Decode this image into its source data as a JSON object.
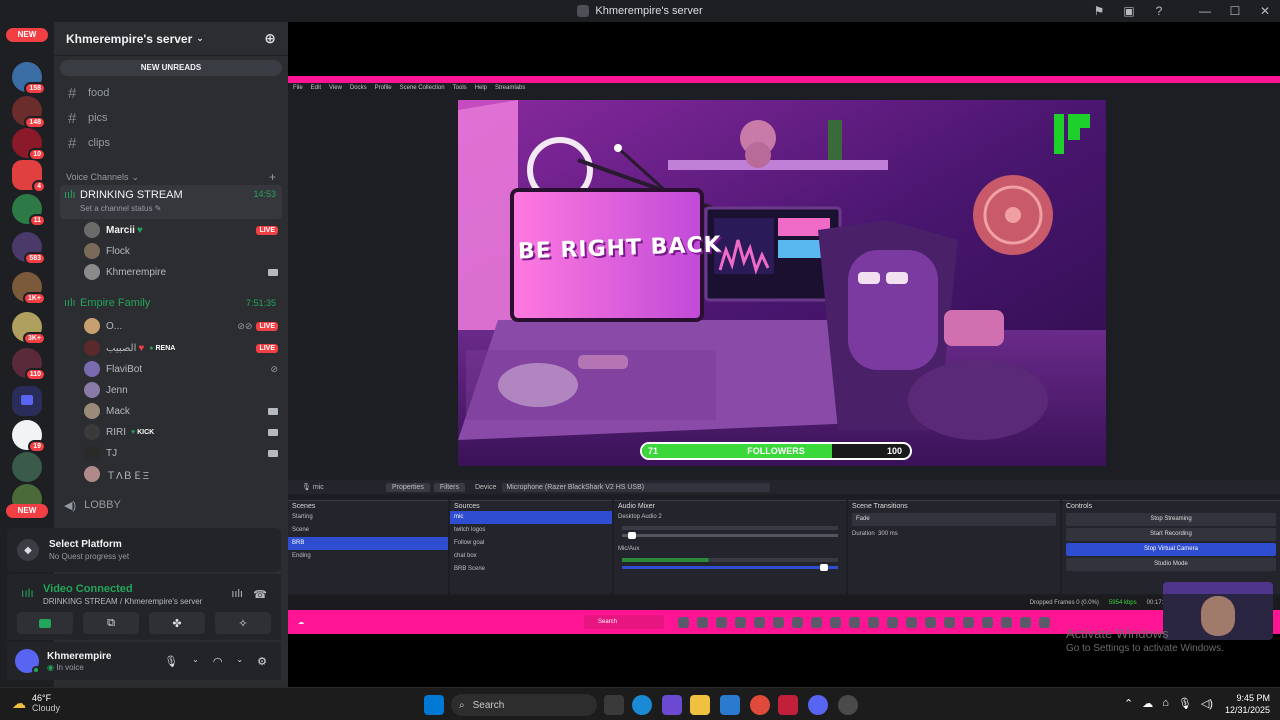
{
  "window": {
    "title": "Khmerempire's server"
  },
  "rail": {
    "new_label_top": "NEW",
    "new_label_bottom": "NEW",
    "badges": [
      "158",
      "148",
      "10",
      "4",
      "11",
      "583",
      "1K+",
      "3K+",
      "110",
      "19"
    ]
  },
  "server": {
    "name": "Khmerempire's server",
    "new_unreads": "NEW UNREADS"
  },
  "text_channels": [
    "food",
    "pics",
    "clips"
  ],
  "voice_category": "Voice Channels",
  "voice_channels": [
    {
      "name": "DRINKING STREAM",
      "time": "14:53",
      "status": "Set a channel status",
      "users": [
        {
          "name": "Marcii",
          "badge": "LIVE"
        },
        {
          "name": "Flock"
        },
        {
          "name": "Khmerempire"
        }
      ]
    },
    {
      "name": "Empire Family",
      "time": "7:51:35",
      "users": [
        {
          "name": "O...",
          "badge": "LIVE"
        },
        {
          "name": "الصبيب",
          "tag": "RENA",
          "badge": "LIVE"
        },
        {
          "name": "FlaviBot"
        },
        {
          "name": "Jenn"
        },
        {
          "name": "Mack"
        },
        {
          "name": "RIRI",
          "tag": "KICK"
        },
        {
          "name": "TJ"
        },
        {
          "name": "ＴΛＢＥΞ"
        }
      ]
    }
  ],
  "lobby": "LOBBY",
  "quest": {
    "title": "Select Platform",
    "subtitle": "No Quest progress yet"
  },
  "voice_connected": {
    "title": "Video Connected",
    "subtitle": "DRINKING STREAM / Khmerempire's server"
  },
  "user": {
    "name": "Khmerempire",
    "status": "In voice"
  },
  "stream": {
    "overlay_text": "BE RIGHT BACK",
    "followers_label": "FOLLOWERS",
    "followers_current": "71",
    "followers_goal": "100",
    "followers_fraction": 0.71
  },
  "obs": {
    "menu": [
      "File",
      "Edit",
      "View",
      "Docks",
      "Profile",
      "Scene Collection",
      "Tools",
      "Help",
      "Streamlabs"
    ],
    "ctx": {
      "props": "Properties",
      "filters": "Filters",
      "device_label": "Device",
      "device": "Microphone (Razer BlackShark V2 HS USB)",
      "selected": "mic"
    },
    "docks": {
      "scenes": "Scenes",
      "sources": "Sources",
      "mixer": "Audio Mixer",
      "transitions": "Scene Transitions",
      "controls": "Controls"
    },
    "scenes": [
      "Starting",
      "Scene",
      "BRB",
      "Ending"
    ],
    "sources": [
      "mic",
      "twitch logos",
      "Follow goal",
      "chat box",
      "BRB Scene"
    ],
    "mixer": [
      "Desktop Audio 2",
      "Mic/Aux"
    ],
    "transition": {
      "type": "Fade",
      "duration_label": "Duration",
      "duration": "300 ms"
    },
    "controls": [
      "Stop Streaming",
      "Start Recording",
      "Stop Virtual Camera",
      "Studio Mode"
    ],
    "status": {
      "dropped": "Dropped Frames 0 (0.0%)",
      "kbps": "5954 kbps",
      "time": "00:17:18"
    },
    "inner_taskbar": {
      "search": "Search"
    }
  },
  "windows_watermark": {
    "line1": "Activate Windows",
    "line2": "Go to Settings to activate Windows."
  },
  "taskbar": {
    "weather_temp": "46°F",
    "weather_desc": "Cloudy",
    "search": "Search",
    "time": "9:45 PM",
    "date": "12/31/2025"
  }
}
